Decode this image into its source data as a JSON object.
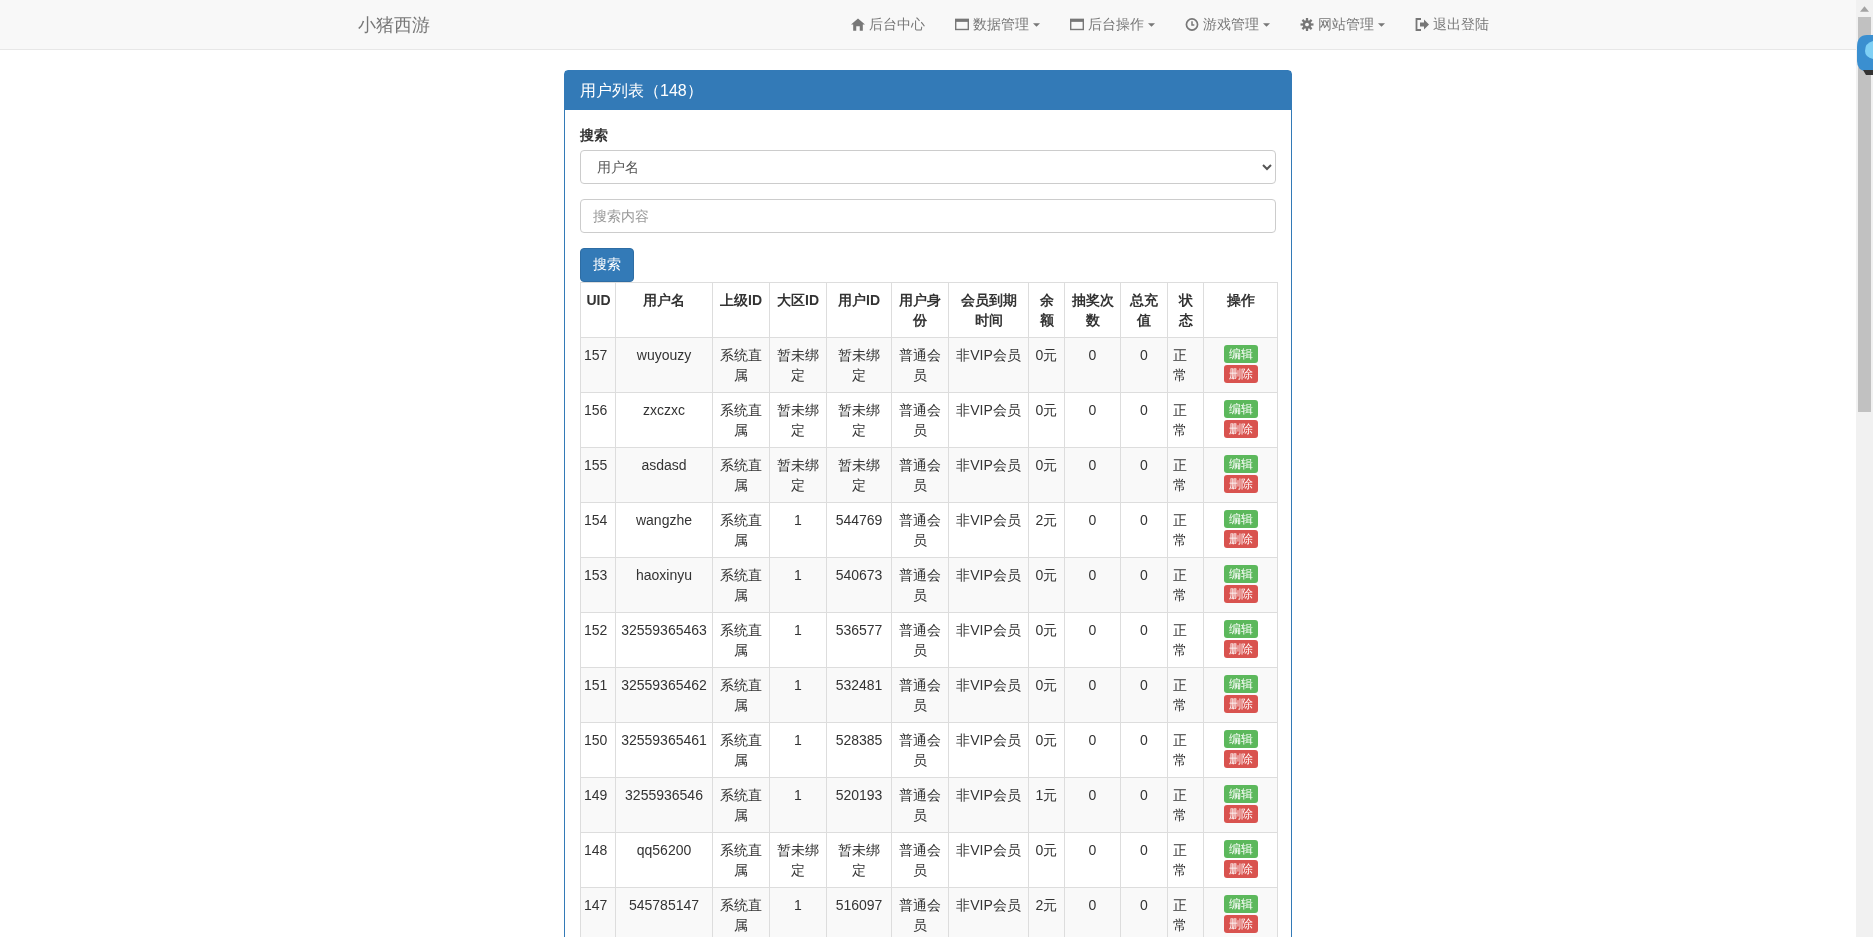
{
  "navbar": {
    "brand": "小猪西游",
    "items": [
      {
        "label": "后台中心",
        "dropdown": false
      },
      {
        "label": "数据管理",
        "dropdown": true
      },
      {
        "label": "后台操作",
        "dropdown": true
      },
      {
        "label": "游戏管理",
        "dropdown": true
      },
      {
        "label": "网站管理",
        "dropdown": true
      },
      {
        "label": "退出登陆",
        "dropdown": false
      }
    ]
  },
  "panel": {
    "title": "用户列表（148）",
    "search": {
      "label": "搜索",
      "type_value": "用户名",
      "placeholder": "搜索内容",
      "button": "搜索"
    },
    "table": {
      "columns": [
        "UID",
        "用户名",
        "上级ID",
        "大区ID",
        "用户ID",
        "用户身份",
        "会员到期时间",
        "余额",
        "抽奖次数",
        "总充值",
        "状态",
        "操作"
      ],
      "rows": [
        {
          "cells": [
            "157",
            "wuyouzy",
            "系统直属",
            "暂未绑定",
            "暂未绑定",
            "普通会员",
            "非VIP会员",
            "0元",
            "0",
            "0",
            "正常"
          ],
          "actions": [
            {
              "label": "编辑",
              "kind": "edit"
            },
            {
              "label": "删除",
              "kind": "delete"
            }
          ]
        },
        {
          "cells": [
            "156",
            "zxczxc",
            "系统直属",
            "暂未绑定",
            "暂未绑定",
            "普通会员",
            "非VIP会员",
            "0元",
            "0",
            "0",
            "正常"
          ],
          "actions": [
            {
              "label": "编辑",
              "kind": "edit"
            },
            {
              "label": "删除",
              "kind": "delete"
            }
          ]
        },
        {
          "cells": [
            "155",
            "asdasd",
            "系统直属",
            "暂未绑定",
            "暂未绑定",
            "普通会员",
            "非VIP会员",
            "0元",
            "0",
            "0",
            "正常"
          ],
          "actions": [
            {
              "label": "编辑",
              "kind": "edit"
            },
            {
              "label": "删除",
              "kind": "delete"
            }
          ]
        },
        {
          "cells": [
            "154",
            "wangzhe",
            "系统直属",
            "1",
            "544769",
            "普通会员",
            "非VIP会员",
            "2元",
            "0",
            "0",
            "正常"
          ],
          "actions": [
            {
              "label": "编辑",
              "kind": "edit"
            },
            {
              "label": "删除",
              "kind": "delete"
            }
          ]
        },
        {
          "cells": [
            "153",
            "haoxinyu",
            "系统直属",
            "1",
            "540673",
            "普通会员",
            "非VIP会员",
            "0元",
            "0",
            "0",
            "正常"
          ],
          "actions": [
            {
              "label": "编辑",
              "kind": "edit"
            },
            {
              "label": "删除",
              "kind": "delete"
            }
          ]
        },
        {
          "cells": [
            "152",
            "32559365463",
            "系统直属",
            "1",
            "536577",
            "普通会员",
            "非VIP会员",
            "0元",
            "0",
            "0",
            "正常"
          ],
          "actions": [
            {
              "label": "编辑",
              "kind": "edit"
            },
            {
              "label": "删除",
              "kind": "delete"
            }
          ]
        },
        {
          "cells": [
            "151",
            "32559365462",
            "系统直属",
            "1",
            "532481",
            "普通会员",
            "非VIP会员",
            "0元",
            "0",
            "0",
            "正常"
          ],
          "actions": [
            {
              "label": "编辑",
              "kind": "edit"
            },
            {
              "label": "删除",
              "kind": "delete"
            }
          ]
        },
        {
          "cells": [
            "150",
            "32559365461",
            "系统直属",
            "1",
            "528385",
            "普通会员",
            "非VIP会员",
            "0元",
            "0",
            "0",
            "正常"
          ],
          "actions": [
            {
              "label": "编辑",
              "kind": "edit"
            },
            {
              "label": "删除",
              "kind": "delete"
            }
          ]
        },
        {
          "cells": [
            "149",
            "3255936546",
            "系统直属",
            "1",
            "520193",
            "普通会员",
            "非VIP会员",
            "1元",
            "0",
            "0",
            "正常"
          ],
          "actions": [
            {
              "label": "编辑",
              "kind": "edit"
            },
            {
              "label": "删除",
              "kind": "delete"
            }
          ]
        },
        {
          "cells": [
            "148",
            "qq56200",
            "系统直属",
            "暂未绑定",
            "暂未绑定",
            "普通会员",
            "非VIP会员",
            "0元",
            "0",
            "0",
            "正常"
          ],
          "actions": [
            {
              "label": "编辑",
              "kind": "edit"
            },
            {
              "label": "删除",
              "kind": "delete"
            }
          ]
        },
        {
          "cells": [
            "147",
            "545785147",
            "系统直属",
            "1",
            "516097",
            "普通会员",
            "非VIP会员",
            "2元",
            "0",
            "0",
            "正常"
          ],
          "actions": [
            {
              "label": "编辑",
              "kind": "edit"
            },
            {
              "label": "删除",
              "kind": "delete"
            }
          ]
        }
      ]
    }
  }
}
